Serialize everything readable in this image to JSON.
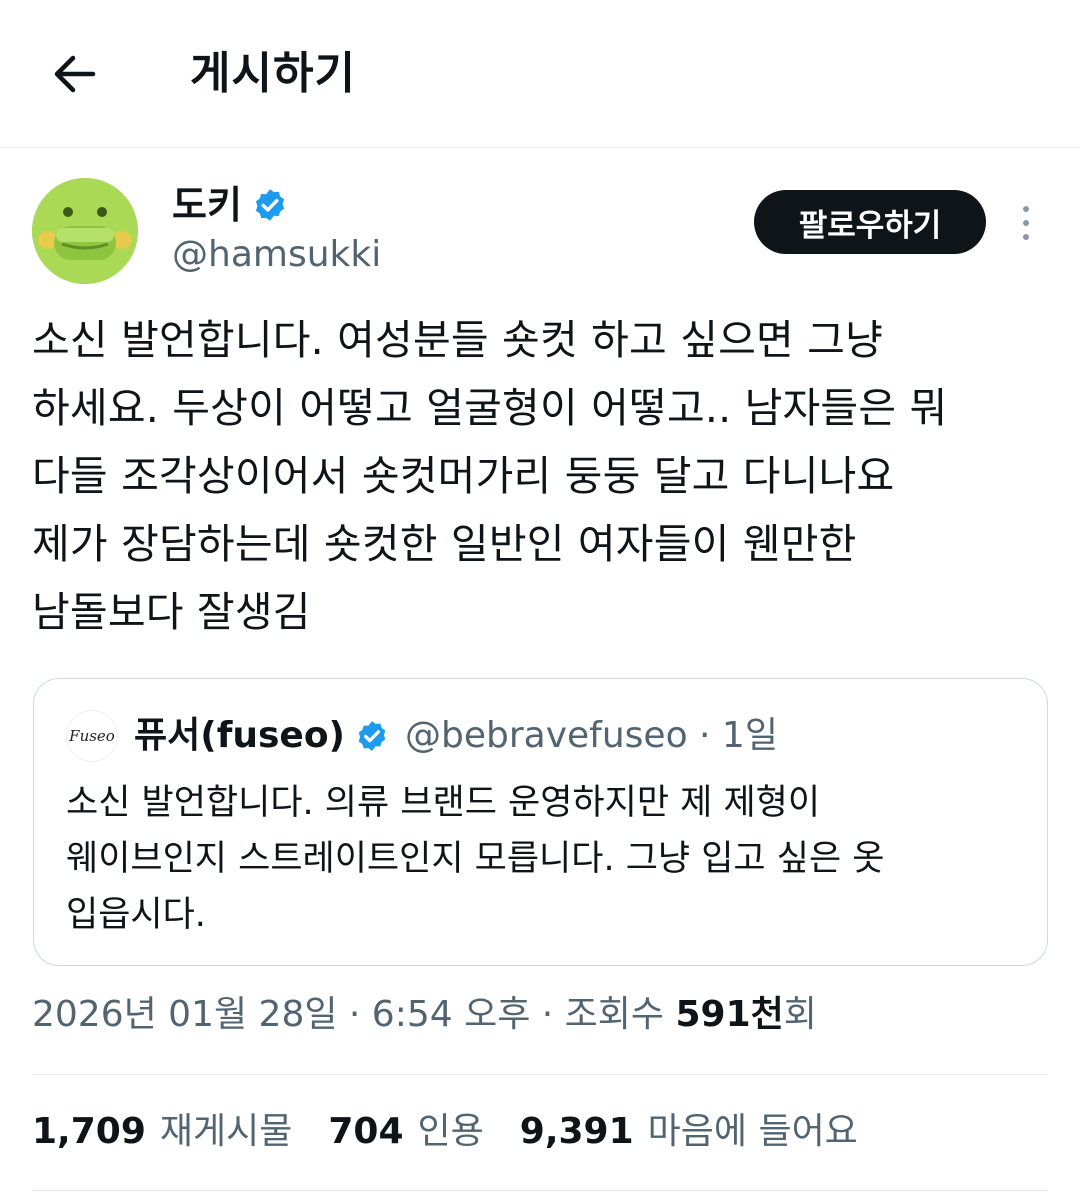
{
  "header": {
    "back_icon": "arrow-left-icon",
    "title": "게시하기"
  },
  "author": {
    "display_name": "도키",
    "handle": "@hamsukki",
    "verified_icon": "verified-badge-icon",
    "follow_label": "팔로우하기",
    "more_icon": "more-vertical-icon"
  },
  "tweet": {
    "text": "소신 발언합니다. 여성분들 숏컷 하고 싶으면 그냥\n하세요. 두상이 어떻고 얼굴형이 어떻고.. 남자들은 뭐\n다들 조각상이어서 숏컷머가리 둥둥 달고 다니나요\n제가 장담하는데 숏컷한 일반인 여자들이 웬만한\n남돌보다 잘생김"
  },
  "quote": {
    "avatar_text": "Fuseo",
    "name": "퓨서(fuseo)",
    "handle_time": "@bebravefuseo · 1일",
    "text": "소신 발언합니다. 의류 브랜드 운영하지만 제 제형이\n웨이브인지 스트레이트인지 모릅니다. 그냥 입고 싶은 옷\n입읍시다."
  },
  "meta": {
    "date_time": "2026년 01월 28일 · 6:54 오후 · 조회수 ",
    "views_num": "591천",
    "views_suffix": "회"
  },
  "stats": {
    "retweets_num": "1,709",
    "retweets_label": "재게시물",
    "quotes_num": "704",
    "quotes_label": "인용",
    "likes_num": "9,391",
    "likes_label": "마음에 들어요"
  },
  "colors": {
    "text_primary": "#0f1419",
    "text_secondary": "#536471",
    "verified_blue": "#1d9bf0",
    "border": "#cfd9de"
  }
}
